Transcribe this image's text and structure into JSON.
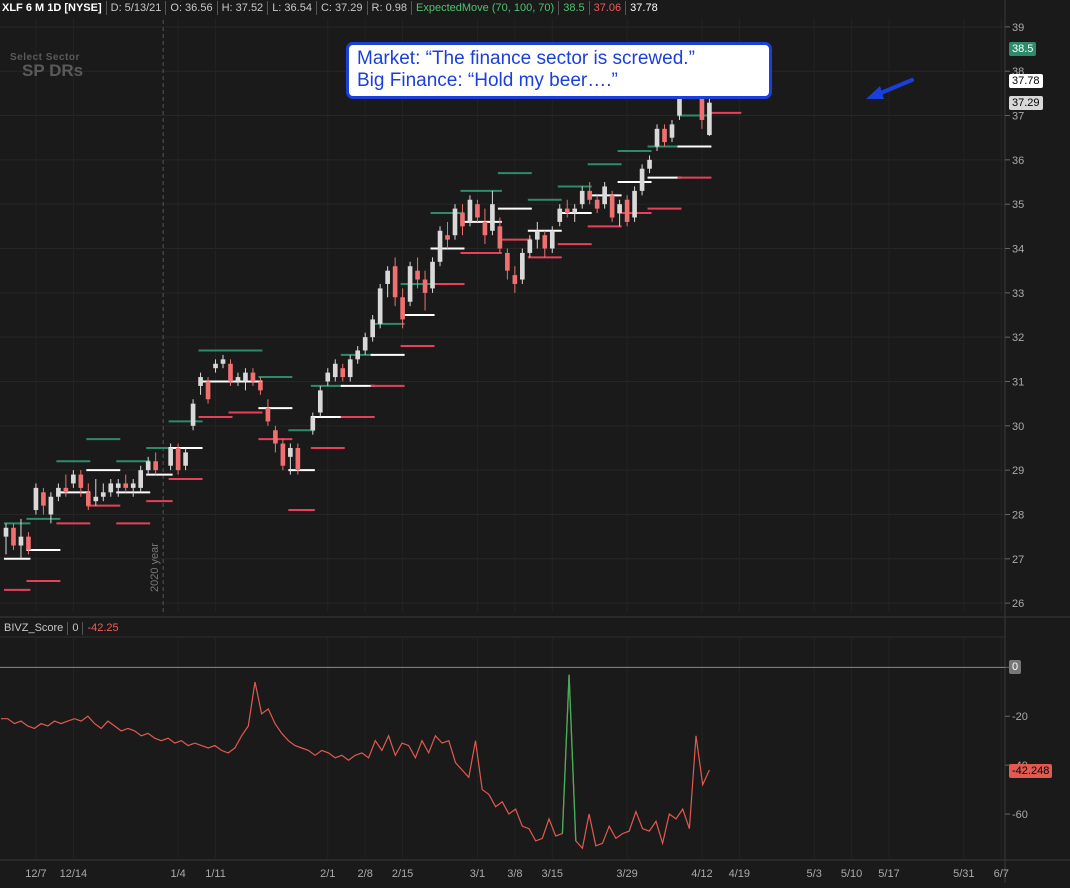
{
  "header": {
    "symbol": "XLF 6 M 1D [NYSE]",
    "date": "D: 5/13/21",
    "open": "O: 36.56",
    "high": "H: 37.52",
    "low": "L: 36.54",
    "close": "C: 37.29",
    "range": "R: 0.98",
    "study": "ExpectedMove (70, 100, 70)",
    "em_upper": "38.5",
    "em_lower": "37.06",
    "em_mid": "37.78"
  },
  "watermark": {
    "line1": "Select Sector",
    "line2": "SP DRs"
  },
  "callout": {
    "line1": "Market: “The finance sector is screwed.”",
    "line2": "Big Finance: “Hold my beer….”"
  },
  "year_label": "2020 year",
  "price_tags": [
    {
      "label": "38.5",
      "value": 38.5,
      "bg": "#2e8b6a",
      "fg": "#ffffff"
    },
    {
      "label": "37.78",
      "value": 37.78,
      "bg": "#ffffff",
      "fg": "#000000"
    },
    {
      "label": "37.29",
      "value": 37.29,
      "bg": "#d8d8d8",
      "fg": "#000000"
    }
  ],
  "lower_panel": {
    "name": "BIVZ_Score",
    "zero_label": "0",
    "current": "-42.25",
    "tag_zero": "0",
    "tag_current": "-42.248"
  },
  "colors": {
    "background": "#1a1a1a",
    "up_candle": "#d9d9d9",
    "down_candle": "#f07070",
    "em_upper": "#2e8b6a",
    "em_mid": "#ffffff",
    "em_lower": "#e8405a",
    "score_line": "#e2594f",
    "callout": "#1b3fdc"
  },
  "chart_data": [
    {
      "type": "candlestick",
      "title": "XLF 6 M 1D [NYSE]",
      "ylim": [
        25.8,
        39.2
      ],
      "y_ticks": [
        26,
        27,
        28,
        29,
        30,
        31,
        32,
        33,
        34,
        35,
        36,
        37,
        38,
        39
      ],
      "x_ticks": [
        "12/7",
        "12/14",
        "1/4",
        "1/11",
        "2/1",
        "2/8",
        "2/15",
        "3/1",
        "3/8",
        "3/15",
        "3/29",
        "4/12",
        "4/19",
        "5/3",
        "5/10",
        "5/17",
        "5/31",
        "6/7"
      ],
      "x_tick_days": [
        4,
        9,
        23,
        28,
        43,
        48,
        53,
        63,
        68,
        73,
        83,
        93,
        98,
        108,
        113,
        118,
        128,
        133
      ],
      "day_range": [
        0,
        135
      ],
      "year_divider_day": 21,
      "candles": [
        {
          "day": 0,
          "o": 27.5,
          "h": 27.8,
          "l": 27.1,
          "c": 27.7
        },
        {
          "day": 1,
          "o": 27.7,
          "h": 27.8,
          "l": 27.2,
          "c": 27.3
        },
        {
          "day": 2,
          "o": 27.3,
          "h": 27.9,
          "l": 27.0,
          "c": 27.5
        },
        {
          "day": 3,
          "o": 27.5,
          "h": 27.6,
          "l": 27.1,
          "c": 27.2
        },
        {
          "day": 4,
          "o": 28.1,
          "h": 28.7,
          "l": 28.0,
          "c": 28.6
        },
        {
          "day": 5,
          "o": 28.5,
          "h": 28.6,
          "l": 28.0,
          "c": 28.2
        },
        {
          "day": 6,
          "o": 28.0,
          "h": 28.5,
          "l": 27.8,
          "c": 28.4
        },
        {
          "day": 7,
          "o": 28.4,
          "h": 28.7,
          "l": 28.3,
          "c": 28.6
        },
        {
          "day": 8,
          "o": 28.6,
          "h": 28.9,
          "l": 28.4,
          "c": 28.5
        },
        {
          "day": 9,
          "o": 28.7,
          "h": 29.0,
          "l": 28.6,
          "c": 28.9
        },
        {
          "day": 10,
          "o": 28.9,
          "h": 29.0,
          "l": 28.4,
          "c": 28.6
        },
        {
          "day": 11,
          "o": 28.5,
          "h": 28.7,
          "l": 28.1,
          "c": 28.2
        },
        {
          "day": 12,
          "o": 28.3,
          "h": 28.8,
          "l": 28.2,
          "c": 28.4
        },
        {
          "day": 13,
          "o": 28.4,
          "h": 28.7,
          "l": 28.3,
          "c": 28.5
        },
        {
          "day": 14,
          "o": 28.5,
          "h": 28.8,
          "l": 28.4,
          "c": 28.7
        },
        {
          "day": 15,
          "o": 28.6,
          "h": 28.8,
          "l": 28.4,
          "c": 28.7
        },
        {
          "day": 16,
          "o": 28.7,
          "h": 28.9,
          "l": 28.5,
          "c": 28.6
        },
        {
          "day": 17,
          "o": 28.6,
          "h": 28.8,
          "l": 28.4,
          "c": 28.7
        },
        {
          "day": 18,
          "o": 28.6,
          "h": 29.1,
          "l": 28.5,
          "c": 29.0
        },
        {
          "day": 19,
          "o": 29.0,
          "h": 29.3,
          "l": 28.9,
          "c": 29.2
        },
        {
          "day": 20,
          "o": 29.2,
          "h": 29.4,
          "l": 28.9,
          "c": 29.0
        },
        {
          "day": 22,
          "o": 29.1,
          "h": 29.6,
          "l": 29.0,
          "c": 29.5
        },
        {
          "day": 23,
          "o": 29.5,
          "h": 29.6,
          "l": 28.9,
          "c": 29.0
        },
        {
          "day": 24,
          "o": 29.1,
          "h": 29.5,
          "l": 29.0,
          "c": 29.4
        },
        {
          "day": 25,
          "o": 30.0,
          "h": 30.6,
          "l": 29.9,
          "c": 30.5
        },
        {
          "day": 26,
          "o": 30.9,
          "h": 31.2,
          "l": 30.7,
          "c": 31.1
        },
        {
          "day": 27,
          "o": 31.0,
          "h": 31.1,
          "l": 30.5,
          "c": 30.6
        },
        {
          "day": 28,
          "o": 31.3,
          "h": 31.5,
          "l": 31.2,
          "c": 31.4
        },
        {
          "day": 29,
          "o": 31.4,
          "h": 31.6,
          "l": 31.3,
          "c": 31.5
        },
        {
          "day": 30,
          "o": 31.4,
          "h": 31.5,
          "l": 30.9,
          "c": 31.0
        },
        {
          "day": 31,
          "o": 31.0,
          "h": 31.2,
          "l": 30.9,
          "c": 31.1
        },
        {
          "day": 32,
          "o": 31.0,
          "h": 31.3,
          "l": 30.8,
          "c": 31.2
        },
        {
          "day": 33,
          "o": 31.2,
          "h": 31.3,
          "l": 30.9,
          "c": 31.0
        },
        {
          "day": 34,
          "o": 31.0,
          "h": 31.1,
          "l": 30.7,
          "c": 30.8
        },
        {
          "day": 35,
          "o": 30.4,
          "h": 30.6,
          "l": 30.0,
          "c": 30.1
        },
        {
          "day": 36,
          "o": 29.9,
          "h": 30.0,
          "l": 29.4,
          "c": 29.6
        },
        {
          "day": 37,
          "o": 29.6,
          "h": 29.7,
          "l": 29.0,
          "c": 29.1
        },
        {
          "day": 38,
          "o": 29.3,
          "h": 29.6,
          "l": 28.9,
          "c": 29.5
        },
        {
          "day": 39,
          "o": 29.5,
          "h": 29.6,
          "l": 28.9,
          "c": 29.0
        },
        {
          "day": 41,
          "o": 29.9,
          "h": 30.3,
          "l": 29.8,
          "c": 30.2
        },
        {
          "day": 42,
          "o": 30.3,
          "h": 30.9,
          "l": 30.2,
          "c": 30.8
        },
        {
          "day": 43,
          "o": 31.0,
          "h": 31.3,
          "l": 30.9,
          "c": 31.2
        },
        {
          "day": 44,
          "o": 31.1,
          "h": 31.5,
          "l": 31.0,
          "c": 31.4
        },
        {
          "day": 45,
          "o": 31.3,
          "h": 31.4,
          "l": 31.0,
          "c": 31.1
        },
        {
          "day": 46,
          "o": 31.1,
          "h": 31.6,
          "l": 31.0,
          "c": 31.5
        },
        {
          "day": 47,
          "o": 31.5,
          "h": 31.8,
          "l": 31.4,
          "c": 31.7
        },
        {
          "day": 48,
          "o": 31.7,
          "h": 32.1,
          "l": 31.6,
          "c": 32.0
        },
        {
          "day": 49,
          "o": 32.0,
          "h": 32.5,
          "l": 31.9,
          "c": 32.4
        },
        {
          "day": 50,
          "o": 32.3,
          "h": 33.2,
          "l": 32.2,
          "c": 33.1
        },
        {
          "day": 51,
          "o": 33.2,
          "h": 33.6,
          "l": 32.9,
          "c": 33.5
        },
        {
          "day": 52,
          "o": 33.6,
          "h": 33.8,
          "l": 32.7,
          "c": 32.9
        },
        {
          "day": 53,
          "o": 32.9,
          "h": 33.1,
          "l": 32.2,
          "c": 32.4
        },
        {
          "day": 54,
          "o": 32.8,
          "h": 33.7,
          "l": 32.7,
          "c": 33.6
        },
        {
          "day": 55,
          "o": 33.5,
          "h": 33.8,
          "l": 33.1,
          "c": 33.3
        },
        {
          "day": 56,
          "o": 33.3,
          "h": 33.5,
          "l": 32.6,
          "c": 33.0
        },
        {
          "day": 57,
          "o": 33.1,
          "h": 33.8,
          "l": 33.0,
          "c": 33.7
        },
        {
          "day": 58,
          "o": 33.7,
          "h": 34.5,
          "l": 33.6,
          "c": 34.4
        },
        {
          "day": 59,
          "o": 34.3,
          "h": 34.6,
          "l": 34.0,
          "c": 34.2
        },
        {
          "day": 60,
          "o": 34.3,
          "h": 35.0,
          "l": 34.2,
          "c": 34.9
        },
        {
          "day": 61,
          "o": 34.8,
          "h": 35.0,
          "l": 34.3,
          "c": 34.5
        },
        {
          "day": 62,
          "o": 34.6,
          "h": 35.2,
          "l": 34.5,
          "c": 35.1
        },
        {
          "day": 63,
          "o": 35.0,
          "h": 35.1,
          "l": 34.6,
          "c": 34.7
        },
        {
          "day": 64,
          "o": 34.6,
          "h": 34.9,
          "l": 34.1,
          "c": 34.3
        },
        {
          "day": 65,
          "o": 34.4,
          "h": 35.3,
          "l": 34.3,
          "c": 35.0
        },
        {
          "day": 66,
          "o": 34.5,
          "h": 34.7,
          "l": 33.9,
          "c": 34.0
        },
        {
          "day": 67,
          "o": 33.9,
          "h": 34.0,
          "l": 33.3,
          "c": 33.5
        },
        {
          "day": 68,
          "o": 33.4,
          "h": 33.6,
          "l": 33.0,
          "c": 33.2
        },
        {
          "day": 69,
          "o": 33.3,
          "h": 34.0,
          "l": 33.2,
          "c": 33.9
        },
        {
          "day": 70,
          "o": 33.9,
          "h": 34.3,
          "l": 33.8,
          "c": 34.2
        },
        {
          "day": 71,
          "o": 34.2,
          "h": 34.6,
          "l": 34.0,
          "c": 34.4
        },
        {
          "day": 72,
          "o": 34.3,
          "h": 34.4,
          "l": 33.8,
          "c": 34.0
        },
        {
          "day": 73,
          "o": 34.0,
          "h": 34.5,
          "l": 33.9,
          "c": 34.4
        },
        {
          "day": 74,
          "o": 34.6,
          "h": 35.0,
          "l": 34.5,
          "c": 34.9
        },
        {
          "day": 75,
          "o": 34.9,
          "h": 35.1,
          "l": 34.7,
          "c": 34.8
        },
        {
          "day": 76,
          "o": 34.8,
          "h": 35.0,
          "l": 34.6,
          "c": 34.9
        },
        {
          "day": 77,
          "o": 35.0,
          "h": 35.4,
          "l": 34.9,
          "c": 35.3
        },
        {
          "day": 78,
          "o": 35.3,
          "h": 35.5,
          "l": 35.0,
          "c": 35.1
        },
        {
          "day": 79,
          "o": 35.1,
          "h": 35.2,
          "l": 34.8,
          "c": 34.9
        },
        {
          "day": 80,
          "o": 35.0,
          "h": 35.5,
          "l": 34.9,
          "c": 35.4
        },
        {
          "day": 81,
          "o": 35.2,
          "h": 35.3,
          "l": 34.6,
          "c": 34.7
        },
        {
          "day": 82,
          "o": 34.8,
          "h": 35.1,
          "l": 34.5,
          "c": 35.0
        },
        {
          "day": 83,
          "o": 35.1,
          "h": 35.2,
          "l": 34.5,
          "c": 34.6
        },
        {
          "day": 84,
          "o": 34.7,
          "h": 35.4,
          "l": 34.6,
          "c": 35.3
        },
        {
          "day": 85,
          "o": 35.3,
          "h": 35.9,
          "l": 35.2,
          "c": 35.8
        },
        {
          "day": 86,
          "o": 35.8,
          "h": 36.1,
          "l": 35.7,
          "c": 36.0
        },
        {
          "day": 87,
          "o": 36.3,
          "h": 36.8,
          "l": 36.2,
          "c": 36.7
        },
        {
          "day": 88,
          "o": 36.7,
          "h": 36.8,
          "l": 36.3,
          "c": 36.4
        },
        {
          "day": 89,
          "o": 36.5,
          "h": 36.9,
          "l": 36.4,
          "c": 36.8
        },
        {
          "day": 90,
          "o": 37.0,
          "h": 37.6,
          "l": 36.9,
          "c": 37.5
        },
        {
          "day": 91,
          "o": 37.6,
          "h": 38.1,
          "l": 37.4,
          "c": 37.9
        },
        {
          "day": 92,
          "o": 37.9,
          "h": 38.3,
          "l": 37.5,
          "c": 37.6
        },
        {
          "day": 93,
          "o": 37.4,
          "h": 37.6,
          "l": 36.7,
          "c": 36.9
        },
        {
          "day": 94,
          "o": 36.56,
          "h": 37.52,
          "l": 36.54,
          "c": 37.29
        }
      ],
      "expected_move_levels": [
        {
          "start": 0,
          "end": 3,
          "upper": 27.8,
          "mid": 27.0,
          "lower": 26.3
        },
        {
          "start": 3,
          "end": 7,
          "upper": 27.9,
          "mid": 27.2,
          "lower": 26.5
        },
        {
          "start": 7,
          "end": 11,
          "upper": 29.2,
          "mid": 28.5,
          "lower": 27.8
        },
        {
          "start": 11,
          "end": 15,
          "upper": 29.7,
          "mid": 29.0,
          "lower": 28.2
        },
        {
          "start": 15,
          "end": 19,
          "upper": 29.2,
          "mid": 28.5,
          "lower": 27.8
        },
        {
          "start": 19,
          "end": 22,
          "upper": 29.5,
          "mid": 28.9,
          "lower": 28.3
        },
        {
          "start": 22,
          "end": 26,
          "upper": 30.1,
          "mid": 29.5,
          "lower": 28.8
        },
        {
          "start": 26,
          "end": 30,
          "upper": 31.7,
          "mid": 31.0,
          "lower": 30.2
        },
        {
          "start": 30,
          "end": 34,
          "upper": 31.7,
          "mid": 31.0,
          "lower": 30.3
        },
        {
          "start": 34,
          "end": 38,
          "upper": 31.1,
          "mid": 30.4,
          "lower": 29.7
        },
        {
          "start": 38,
          "end": 41,
          "upper": 29.9,
          "mid": 29.0,
          "lower": 28.1
        },
        {
          "start": 41,
          "end": 45,
          "upper": 30.9,
          "mid": 30.2,
          "lower": 29.5
        },
        {
          "start": 45,
          "end": 49,
          "upper": 31.6,
          "mid": 30.9,
          "lower": 30.2
        },
        {
          "start": 49,
          "end": 53,
          "upper": 32.3,
          "mid": 31.6,
          "lower": 30.9
        },
        {
          "start": 53,
          "end": 57,
          "upper": 33.2,
          "mid": 32.5,
          "lower": 31.8
        },
        {
          "start": 57,
          "end": 61,
          "upper": 34.8,
          "mid": 34.0,
          "lower": 33.2
        },
        {
          "start": 61,
          "end": 66,
          "upper": 35.3,
          "mid": 34.6,
          "lower": 33.9
        },
        {
          "start": 66,
          "end": 70,
          "upper": 35.7,
          "mid": 34.9,
          "lower": 34.2
        },
        {
          "start": 70,
          "end": 74,
          "upper": 35.1,
          "mid": 34.4,
          "lower": 33.8
        },
        {
          "start": 74,
          "end": 78,
          "upper": 35.4,
          "mid": 34.8,
          "lower": 34.1
        },
        {
          "start": 78,
          "end": 82,
          "upper": 35.9,
          "mid": 35.2,
          "lower": 34.5
        },
        {
          "start": 82,
          "end": 86,
          "upper": 36.2,
          "mid": 35.5,
          "lower": 34.8
        },
        {
          "start": 86,
          "end": 90,
          "upper": 36.3,
          "mid": 35.6,
          "lower": 34.9
        },
        {
          "start": 90,
          "end": 94,
          "upper": 37.0,
          "mid": 36.3,
          "lower": 35.6
        },
        {
          "start": 94,
          "end": 98,
          "upper": 38.5,
          "mid": 37.78,
          "lower": 37.06
        }
      ]
    },
    {
      "type": "line",
      "title": "BIVZ_Score",
      "ylim": [
        -78,
        12
      ],
      "y_ticks": [
        0,
        -20,
        -40,
        -60
      ],
      "series": [
        {
          "values": [
            -21,
            -21,
            -23,
            -22,
            -24,
            -25,
            -23,
            -24,
            -22,
            -23,
            -22,
            -21,
            -22,
            -20,
            -23,
            -25,
            -22,
            -24,
            -26,
            -25,
            -26,
            -28,
            -27,
            -29,
            -30,
            -29,
            -31,
            -30,
            -32,
            -31,
            -32,
            -33,
            -32,
            -34,
            -35,
            -33,
            -28,
            -24,
            -6,
            -19,
            -17,
            -23,
            -27,
            -30,
            -32,
            -33,
            -34,
            -36,
            -34,
            -35,
            -37,
            -36,
            -38,
            -36,
            -35,
            -37,
            -30,
            -34,
            -28,
            -36,
            -31,
            -32,
            -37,
            -30,
            -35,
            -28,
            -31,
            -30,
            -39,
            -42,
            -45,
            -30,
            -50,
            -52,
            -57,
            -55,
            -60,
            -58,
            -65,
            -66,
            -71,
            -70,
            -62,
            -69,
            -68,
            -3,
            -71,
            -74,
            -60,
            -73,
            -72,
            -65,
            -70,
            -68,
            -67,
            -59,
            -66,
            -67,
            -63,
            -72,
            -60,
            -62,
            -58,
            -66,
            -28,
            -48,
            -42
          ]
        }
      ]
    }
  ]
}
